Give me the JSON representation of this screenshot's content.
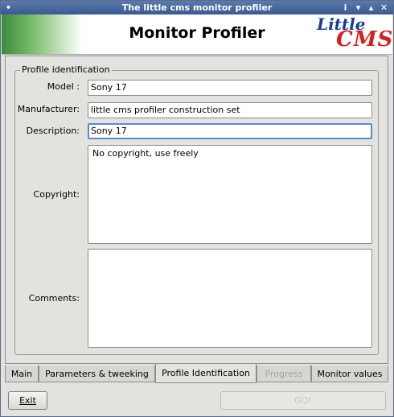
{
  "window": {
    "title": "The little cms monitor profiler",
    "buttons": [
      "i",
      "v",
      "^",
      "x"
    ]
  },
  "banner": {
    "title": "Monitor Profiler",
    "logo_line1": "Little",
    "logo_line2": "CMS"
  },
  "group": {
    "legend": "Profile identification"
  },
  "fields": {
    "model_label": "Model :",
    "model_value": "Sony 17",
    "manufacturer_label": "Manufacturer:",
    "manufacturer_value": "little cms profiler construction set",
    "description_label": "Description:",
    "description_value": "Sony 17",
    "copyright_label": "Copyright:",
    "copyright_value": "No copyright, use freely",
    "comments_label": "Comments:",
    "comments_value": ""
  },
  "tabs": [
    {
      "label": "Main",
      "state": "normal"
    },
    {
      "label": "Parameters & tweeking",
      "state": "normal"
    },
    {
      "label": "Profile Identification",
      "state": "active"
    },
    {
      "label": "Progress",
      "state": "disabled"
    },
    {
      "label": "Monitor values",
      "state": "normal"
    }
  ],
  "actions": {
    "exit_label": "Exit",
    "go_label": "GO!"
  }
}
